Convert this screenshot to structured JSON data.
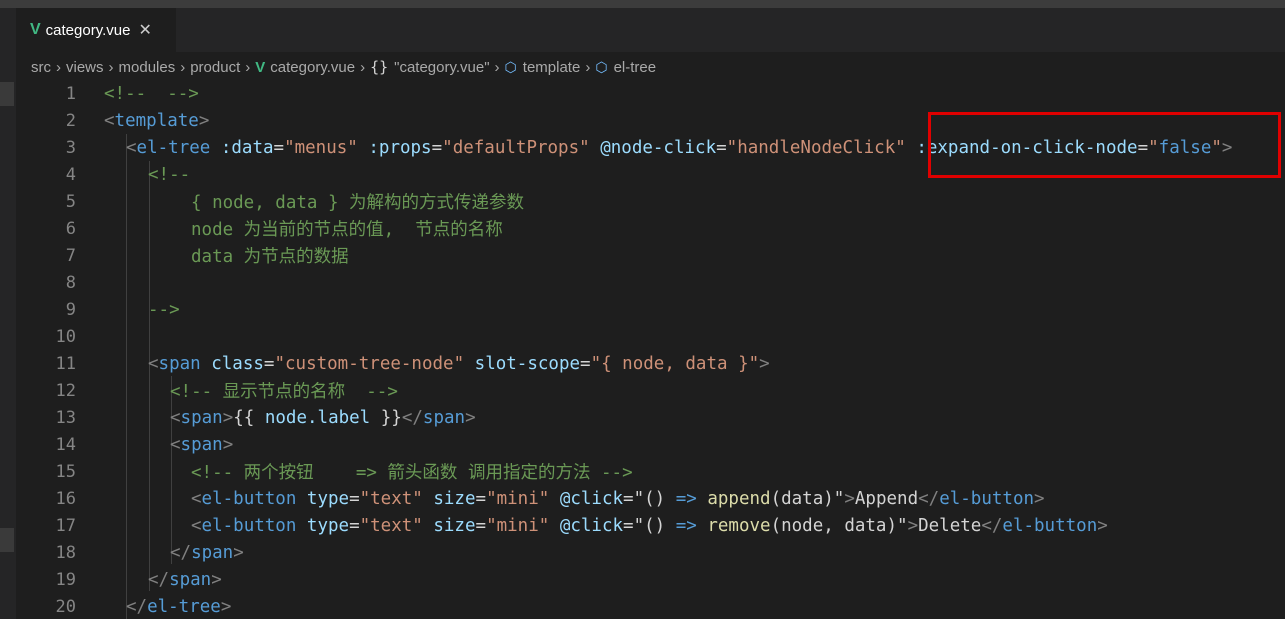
{
  "tab": {
    "icon": "vue-icon",
    "label": "category.vue"
  },
  "breadcrumb": {
    "items": [
      "src",
      "views",
      "modules",
      "product",
      "category.vue",
      "\"category.vue\"",
      "template",
      "el-tree"
    ]
  },
  "lines": [
    {
      "n": "1"
    },
    {
      "n": "2"
    },
    {
      "n": "3"
    },
    {
      "n": "4"
    },
    {
      "n": "5"
    },
    {
      "n": "6"
    },
    {
      "n": "7"
    },
    {
      "n": "8"
    },
    {
      "n": "9"
    },
    {
      "n": "10"
    },
    {
      "n": "11"
    },
    {
      "n": "12"
    },
    {
      "n": "13"
    },
    {
      "n": "14"
    },
    {
      "n": "15"
    },
    {
      "n": "16"
    },
    {
      "n": "17"
    },
    {
      "n": "18"
    },
    {
      "n": "19"
    },
    {
      "n": "20"
    }
  ],
  "code": {
    "l1": "<!--  -->",
    "l2_open": "<",
    "l2_tag": "template",
    "l2_close": ">",
    "l3": {
      "lt": "<",
      "tag": "el-tree",
      "a1": " :data",
      "eq1": "=",
      "v1": "\"menus\"",
      "a2": " :props",
      "eq2": "=",
      "v2": "\"defaultProps\"",
      "a3": " @node-click",
      "eq3": "=",
      "v3": "\"handleNodeClick\"",
      "a4": " :expand-on-click-node",
      "eq4": "=",
      "q4a": "\"",
      "v4": "false",
      "q4b": "\"",
      "gt": ">"
    },
    "l4": "<!--",
    "l5": "{ node, data } 为解构的方式传递参数",
    "l6": "node 为当前的节点的值,  节点的名称",
    "l7": "data 为节点的数据",
    "l9": "-->",
    "l11": {
      "lt": "<",
      "tag": "span",
      "a1": " class",
      "eq1": "=",
      "v1": "\"custom-tree-node\"",
      "a2": " slot-scope",
      "eq2": "=",
      "v2": "\"{ node, data }\"",
      "gt": ">"
    },
    "l12": "<!-- 显示节点的名称  -->",
    "l13": {
      "lt": "<",
      "tag": "span",
      "gt": ">",
      "t1": "{{ ",
      "v": "node.label",
      "t2": " }}",
      "clt": "</",
      "ctag": "span",
      "cgt": ">"
    },
    "l14": {
      "lt": "<",
      "tag": "span",
      "gt": ">"
    },
    "l15": "<!-- 两个按钮    => 箭头函数 调用指定的方法 -->",
    "l16": {
      "lt": "<",
      "tag": "el-button",
      "a1": " type",
      "eq1": "=",
      "v1": "\"text\"",
      "a2": " size",
      "eq2": "=",
      "v2": "\"mini\"",
      "a3": " @click",
      "eq3": "=",
      "q1": "\"()",
      "arrow": " =>",
      "fn": " append",
      "args": "(data)",
      "q2": "\"",
      "gt": ">",
      "text": "Append",
      "clt": "</",
      "ctag": "el-button",
      "cgt": ">"
    },
    "l17": {
      "lt": "<",
      "tag": "el-button",
      "a1": " type",
      "eq1": "=",
      "v1": "\"text\"",
      "a2": " size",
      "eq2": "=",
      "v2": "\"mini\"",
      "a3": " @click",
      "eq3": "=",
      "q1": "\"()",
      "arrow": " =>",
      "fn": " remove",
      "args": "(node, data)",
      "q2": "\"",
      "gt": ">",
      "text": "Delete",
      "clt": "</",
      "ctag": "el-button",
      "cgt": ">"
    },
    "l18": {
      "lt": "</",
      "tag": "span",
      "gt": ">"
    },
    "l19": {
      "lt": "</",
      "tag": "span",
      "gt": ">"
    },
    "l20": {
      "lt": "</",
      "tag": "el-tree",
      "gt": ">"
    }
  },
  "colors": {
    "highlight_box": "#e00000",
    "vue_green": "#41b883"
  }
}
